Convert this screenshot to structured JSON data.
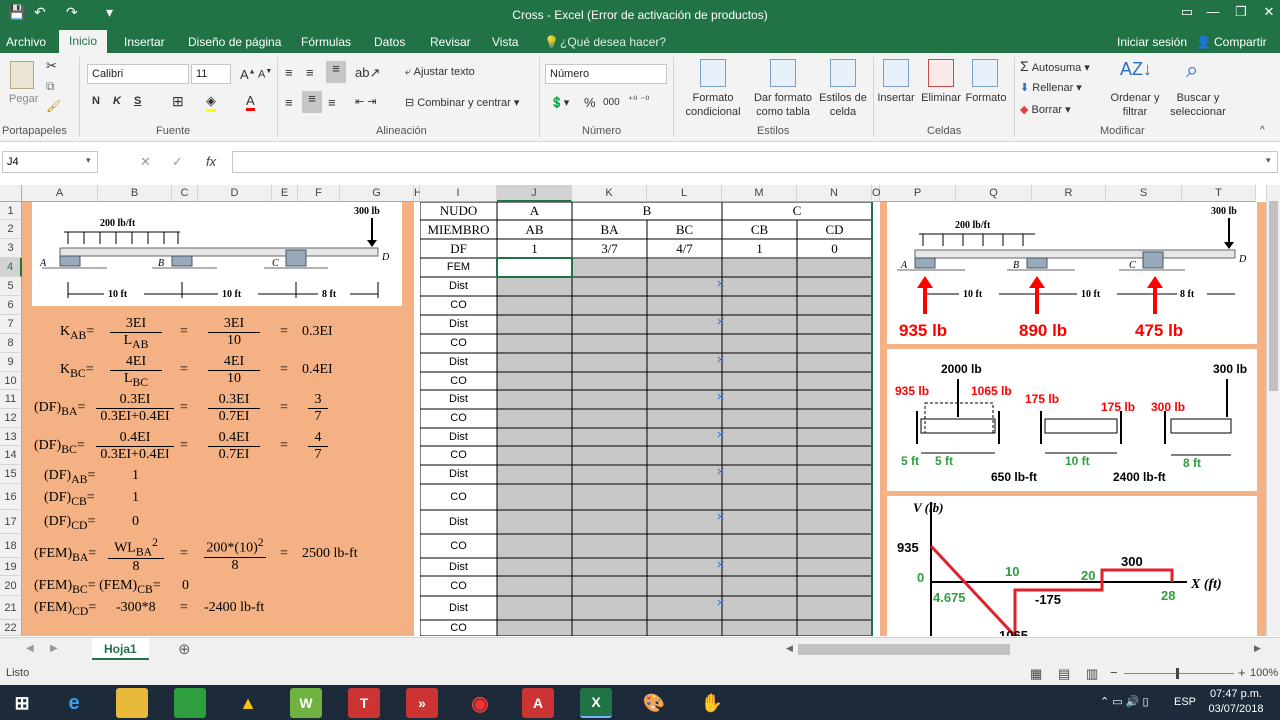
{
  "window": {
    "title": "Cross - Excel (Error de activación de productos)"
  },
  "quick_access": {
    "save": "💾",
    "undo": "↶",
    "redo": "↷",
    "customize": "▾"
  },
  "menu": {
    "tabs": [
      "Archivo",
      "Inicio",
      "Insertar",
      "Diseño de página",
      "Fórmulas",
      "Datos",
      "Revisar",
      "Vista"
    ],
    "tell_me": "¿Qué desea hacer?",
    "signin": "Iniciar sesión",
    "share": "Compartir"
  },
  "ribbon": {
    "clipboard": {
      "paste": "Pegar",
      "label": "Portapapeles"
    },
    "font": {
      "name": "Calibri",
      "size": "11",
      "bold": "N",
      "italic": "K",
      "underline": "S",
      "label": "Fuente"
    },
    "alignment": {
      "wrap": "Ajustar texto",
      "merge": "Combinar y centrar",
      "label": "Alineación"
    },
    "number": {
      "format": "Número",
      "percent": "%",
      "comma": "000",
      "label": "Número"
    },
    "styles": {
      "conditional": "Formato condicional",
      "table": "Dar formato como tabla",
      "cell_styles": "Estilos de celda",
      "label": "Estilos"
    },
    "cells": {
      "insert": "Insertar",
      "delete": "Eliminar",
      "format": "Formato",
      "label": "Celdas"
    },
    "editing": {
      "autosum": "Autosuma",
      "fill": "Rellenar",
      "clear": "Borrar",
      "sort": "Ordenar y filtrar",
      "find": "Buscar y seleccionar",
      "label": "Modificar"
    }
  },
  "formula_bar": {
    "name_box": "J4",
    "fx": "fx",
    "value": ""
  },
  "columns": [
    "A",
    "B",
    "C",
    "D",
    "E",
    "F",
    "G",
    "H",
    "I",
    "J",
    "K",
    "L",
    "M",
    "N",
    "O",
    "P",
    "Q",
    "R",
    "S",
    "T"
  ],
  "rows": [
    "1",
    "2",
    "3",
    "4",
    "5",
    "6",
    "7",
    "8",
    "9",
    "10",
    "11",
    "12",
    "13",
    "14",
    "15",
    "16",
    "17",
    "18",
    "19",
    "20",
    "21",
    "22"
  ],
  "table": {
    "nudo_label": "NUDO",
    "miembro_label": "MIEMBRO",
    "df_label": "DF",
    "nodes": [
      "A",
      "B",
      "C"
    ],
    "members": [
      "AB",
      "BA",
      "BC",
      "CB",
      "CD"
    ],
    "df_values": [
      "1",
      "3/7",
      "4/7",
      "1",
      "0"
    ],
    "row_labels": [
      "FEM",
      "Dist",
      "CO",
      "Dist",
      "CO",
      "Dist",
      "CO",
      "Dist",
      "CO",
      "Dist",
      "CO",
      "Dist",
      "CO",
      "Dist",
      "CO",
      "Dist",
      "CO",
      "Dist",
      "CO"
    ]
  },
  "beam": {
    "dist_load": "200 lb/ft",
    "point_load": "300 lb",
    "supports": [
      "A",
      "B",
      "C",
      "D"
    ],
    "spans": [
      "10 ft",
      "10 ft",
      "8 ft"
    ],
    "reactions": [
      "935 lb",
      "890 lb",
      "475 lb"
    ]
  },
  "fbd": {
    "resultant": "2000 lb",
    "ra": "935 lb",
    "rb_left": "1065 lb",
    "shear_b": "175 lb",
    "shear_c": "175 lb",
    "rc": "300 lb",
    "pd": "300 lb",
    "dims_ab": [
      "5 ft",
      "5 ft"
    ],
    "dim_bc": "10 ft",
    "dim_cd": "8 ft",
    "moment_b": "650 lb-ft",
    "moment_c": "2400 lb-ft"
  },
  "shear_diagram": {
    "ylabel": "V (lb)",
    "xlabel": "X (ft)",
    "labels": [
      "935",
      "0",
      "4.675",
      "10",
      "-175",
      "20",
      "300",
      "28",
      "1065"
    ]
  },
  "calcs": {
    "kab": [
      "K",
      "AB",
      "=",
      "3EI",
      "L",
      "AB",
      "=",
      "3EI",
      "10",
      "=",
      "0.3EI"
    ],
    "kbc": [
      "K",
      "BC",
      "=",
      "4EI",
      "L",
      "BC",
      "=",
      "4EI",
      "10",
      "=",
      "0.4EI"
    ],
    "dfba": [
      "(DF)",
      "BA",
      "=",
      "0.3EI",
      "0.3EI+0.4EI",
      "=",
      "0.3EI",
      "0.7EI",
      "=",
      "3",
      "7"
    ],
    "dfbc": [
      "(DF)",
      "BC",
      "=",
      "0.4EI",
      "0.3EI+0.4EI",
      "=",
      "0.4EI",
      "0.7EI",
      "=",
      "4",
      "7"
    ],
    "dfab": [
      "(DF)",
      "AB",
      "=",
      "1"
    ],
    "dfcb": [
      "(DF)",
      "CB",
      "=",
      "1"
    ],
    "dfcd": [
      "(DF)",
      "CD",
      "=",
      "0"
    ],
    "femba": [
      "(FEM)",
      "BA",
      "=",
      "WL",
      "BA",
      "2",
      "8",
      "=",
      "200*(10)",
      "2",
      "8",
      "=",
      "2500  lb-ft"
    ],
    "fembc": [
      "(FEM)",
      "BC",
      "=",
      "(FEM)",
      "CB",
      "=",
      "0"
    ],
    "femcd": [
      "(FEM)",
      "CD",
      "=",
      "-300*8",
      "=",
      "-2400 lb-ft"
    ]
  },
  "sheet_tabs": [
    "Hoja1"
  ],
  "status": {
    "ready": "Listo",
    "zoom": "100%"
  },
  "taskbar": {
    "time": "07:47 p.m.",
    "date": "03/07/2018",
    "lang": "ESP"
  },
  "colors": {
    "excel_green": "#217346",
    "salmon": "#f4b183",
    "gray_cells": "#c8c8c8",
    "red": "#ff0000"
  }
}
